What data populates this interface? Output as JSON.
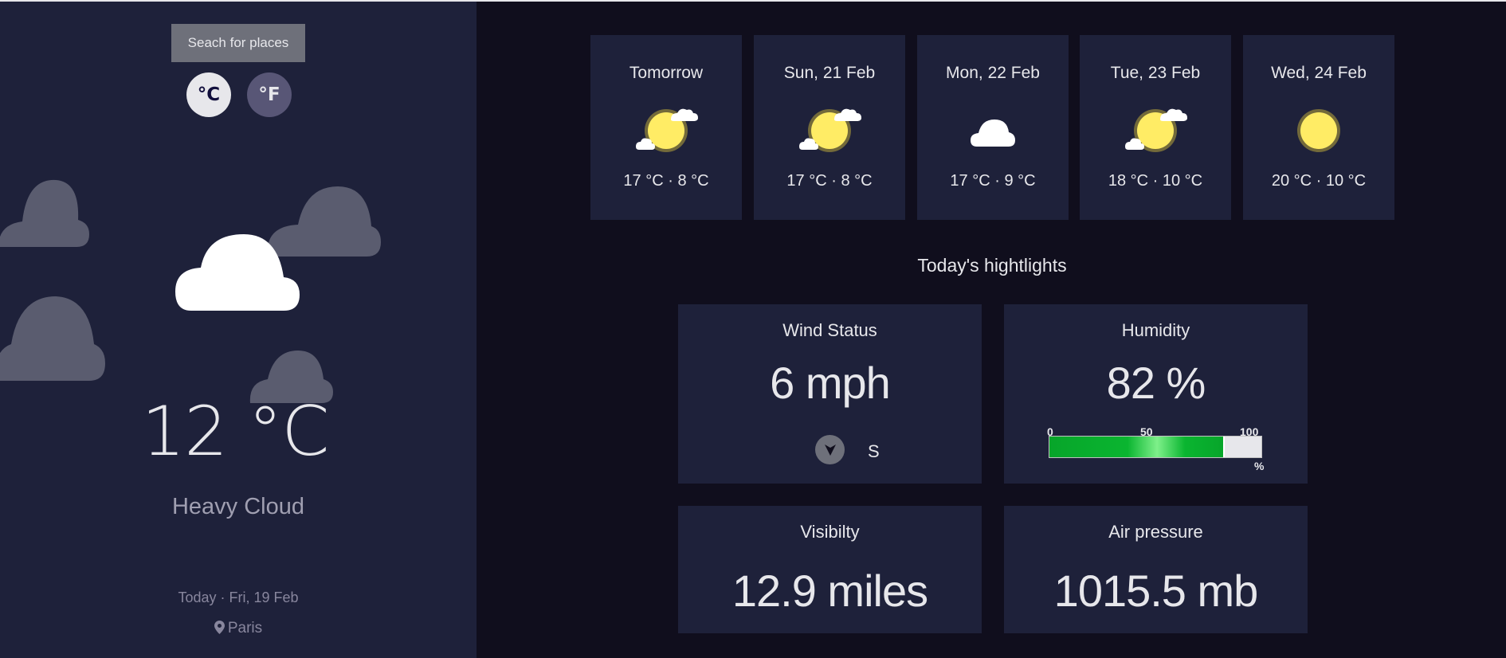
{
  "search": {
    "label": "Seach for places"
  },
  "units": {
    "celsius": "°C",
    "fahrenheit": "°F"
  },
  "current": {
    "temperature": "12 °C",
    "condition": "Heavy Cloud",
    "date": "Today · Fri, 19 Feb",
    "location": "Paris",
    "icon": "heavy-cloud-icon"
  },
  "forecast": [
    {
      "day": "Tomorrow",
      "temps": "17 °C · 8 °C",
      "icon": "light-cloud-icon"
    },
    {
      "day": "Sun, 21 Feb",
      "temps": "17 °C · 8 °C",
      "icon": "light-cloud-icon"
    },
    {
      "day": "Mon, 22 Feb",
      "temps": "17 °C · 9 °C",
      "icon": "heavy-cloud-icon"
    },
    {
      "day": "Tue, 23 Feb",
      "temps": "18 °C · 10 °C",
      "icon": "light-cloud-icon"
    },
    {
      "day": "Wed, 24 Feb",
      "temps": "20 °C · 10 °C",
      "icon": "clear-icon"
    }
  ],
  "highlights": {
    "title": "Today's hightlights",
    "wind": {
      "label": "Wind Status",
      "value": "6 mph",
      "direction": "S"
    },
    "humidity": {
      "label": "Humidity",
      "value": "82 %",
      "percent": 82,
      "scale": [
        "0",
        "50",
        "100"
      ],
      "unit": "%"
    },
    "visibility": {
      "label": "Visibilty",
      "value": "12.9 miles"
    },
    "pressure": {
      "label": "Air pressure",
      "value": "1015.5 mb"
    }
  },
  "colors": {
    "sidebar": "#1e213a",
    "background": "#100e1d",
    "text": "#e7e7eb",
    "muted": "#88869d",
    "humidity_bar": "#0ab530",
    "sun": "#ffec65"
  }
}
